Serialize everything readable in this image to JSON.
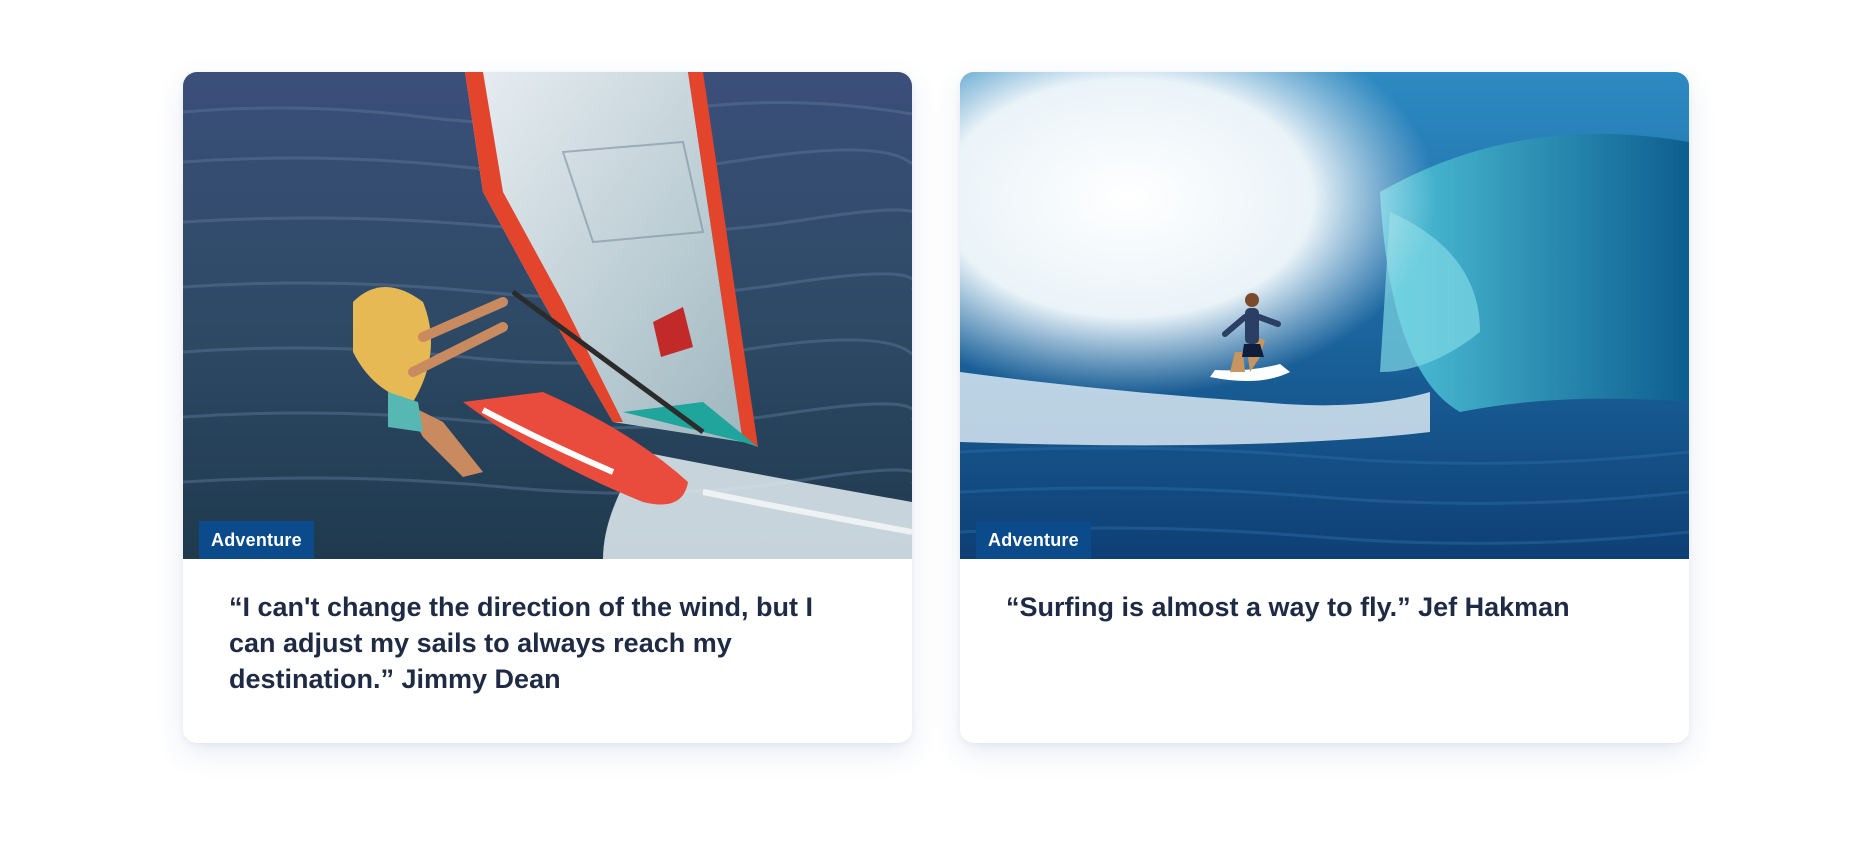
{
  "cards": [
    {
      "badge": "Adventure",
      "quote": "“I can't change the direction of the wind, but I can adjust my sails to always reach my destination.” Jimmy Dean",
      "image_subject": "windsurfer-photo"
    },
    {
      "badge": "Adventure",
      "quote": "“Surfing is almost a way to fly.” Jef Hakman",
      "image_subject": "surfer-wave-photo"
    }
  ],
  "colors": {
    "badge_background": "#0b4a8b",
    "quote_text": "#1f2a44",
    "page_background": "#ffffff"
  }
}
